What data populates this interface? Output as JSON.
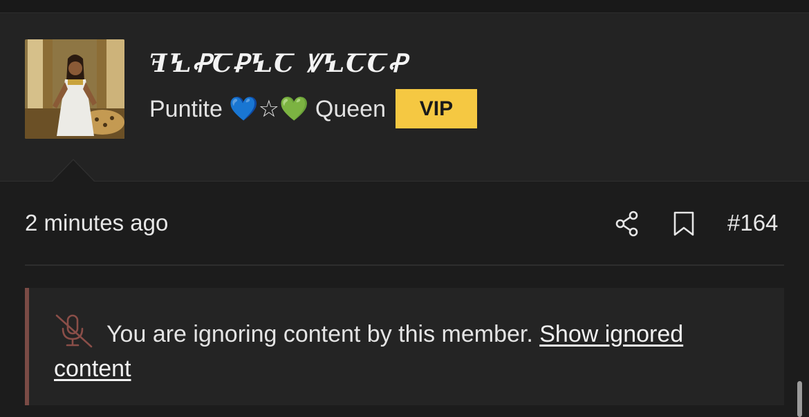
{
  "author": {
    "username": "ꟻꝆꝒꞆꝐꝆꞆ ꝞꝆꞆꞆꝒ",
    "user_title": "Puntite 💙☆💚 Queen",
    "badge": "VIP",
    "badge_color": "#f5c842"
  },
  "post": {
    "timestamp": "2 minutes ago",
    "number": "#164",
    "icons": [
      "share-icon",
      "bookmark-icon"
    ]
  },
  "ignored": {
    "message": "You are ignoring content by this member.",
    "link_label": "Show ignored content",
    "icon": "microphone-muted-icon",
    "accent_color": "#7a4b45"
  }
}
